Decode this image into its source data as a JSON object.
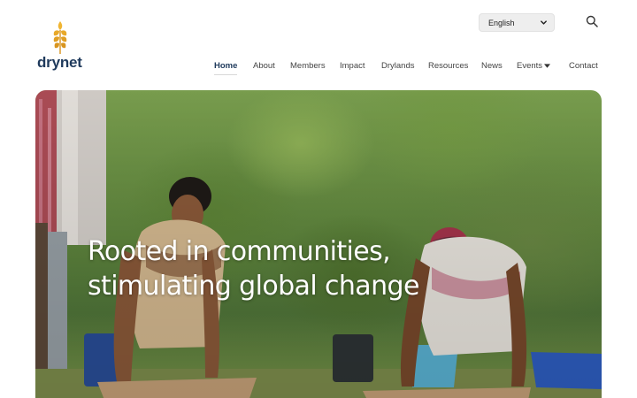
{
  "brand": {
    "name": "drynet",
    "logo_icon": "wheat-icon",
    "color": "#1f3a5c",
    "logo_color": "#e8a92a"
  },
  "language": {
    "selected": "English"
  },
  "search": {
    "icon": "search-icon"
  },
  "nav": {
    "items": [
      {
        "label": "Home",
        "active": true
      },
      {
        "label": "About"
      },
      {
        "label": "Members"
      },
      {
        "label": "Impact"
      },
      {
        "label": "Drylands"
      },
      {
        "label": "Resources"
      },
      {
        "label": "News"
      },
      {
        "label": "Events",
        "has_dropdown": true
      },
      {
        "label": "Contact"
      }
    ]
  },
  "hero": {
    "heading": "Rooted in communities, stimulating global change"
  }
}
